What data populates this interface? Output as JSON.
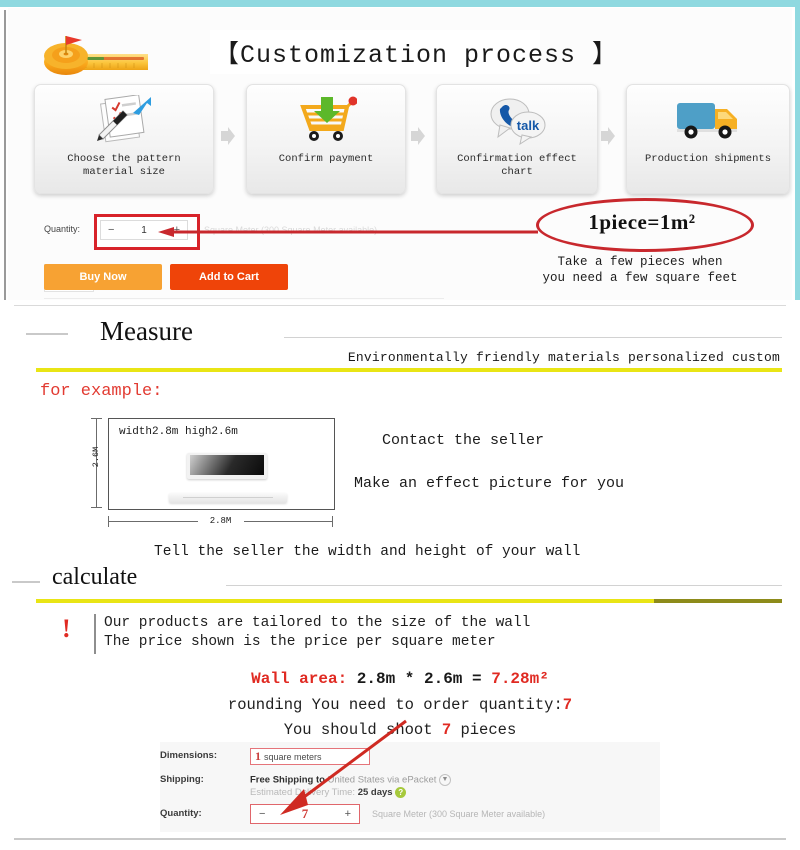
{
  "colors": {
    "teal": "#8fd9e0",
    "red": "#d8232a",
    "orange_buy": "#f7a233",
    "orange_cart": "#ef4409",
    "yellow_bar": "#e9e515",
    "yellow_bar_dark": "#8d8b1a"
  },
  "panel1": {
    "title": "【Customization process 】",
    "tape_icon": "tape-measure-icon",
    "steps": [
      {
        "icon": "document-pen-icon",
        "label": "Choose the pattern material size"
      },
      {
        "icon": "shopping-cart-download-icon",
        "label": "Confirm payment"
      },
      {
        "icon": "chat-talk-icon",
        "label": "Confirmation effect chart"
      },
      {
        "icon": "delivery-truck-icon",
        "label": "Production shipments"
      }
    ],
    "quantity": {
      "label": "Quantity:",
      "minus": "−",
      "value": "1",
      "plus": "+",
      "availability": "Square Meter (300 Square Meter available)"
    },
    "callout": {
      "equation": "1piece=1m²",
      "note_line1": "Take a few pieces when",
      "note_line2": "you need a few square feet"
    },
    "buttons": {
      "buy_now": "Buy Now",
      "add_to_cart": "Add to Cart",
      "favorite_icon": "heart-icon"
    }
  },
  "panel2": {
    "measure": {
      "heading": "Measure",
      "tagline": "Environmentally friendly materials personalized custom",
      "for_example": "for example:",
      "diagram": {
        "inside_label": "width2.8m  high2.6m",
        "vertical_dim": "2.6M",
        "horizontal_dim": "2.8M",
        "tv_icon": "television-icon"
      },
      "contact": "Contact the seller",
      "effect": "Make an effect picture for you",
      "tell": "Tell the seller the width and height of your wall"
    },
    "calculate": {
      "heading": "calculate",
      "warn_icon": "exclamation-icon",
      "warn_line1": "Our products are tailored to the size of the wall",
      "warn_line2": "The price shown is the price per square meter",
      "wall_area_label": "Wall area:",
      "wall_area_expr": " 2.8m * 2.6m = ",
      "wall_area_result": "7.28m²",
      "rounding_text": "rounding  You need to order quantity:",
      "rounding_qty": "7",
      "shoot_prefix": "You should shoot ",
      "shoot_qty": "7",
      "shoot_suffix": " pieces",
      "mock": {
        "dimensions_label": "Dimensions:",
        "dimensions_value": "1",
        "dimensions_unit": "square meters",
        "shipping_label": "Shipping:",
        "shipping_bold": "Free Shipping to",
        "shipping_rest": " United States via ePacket",
        "shipping_caret_icon": "chevron-down-icon",
        "delivery_label": "Estimated Delivery Time: ",
        "delivery_value": "25 days",
        "delivery_help_icon": "question-mark-icon",
        "quantity_label": "Quantity:",
        "qty_minus": "−",
        "qty_value": "7",
        "qty_plus": "+",
        "qty_availability": "Square Meter (300 Square Meter available)"
      }
    }
  }
}
